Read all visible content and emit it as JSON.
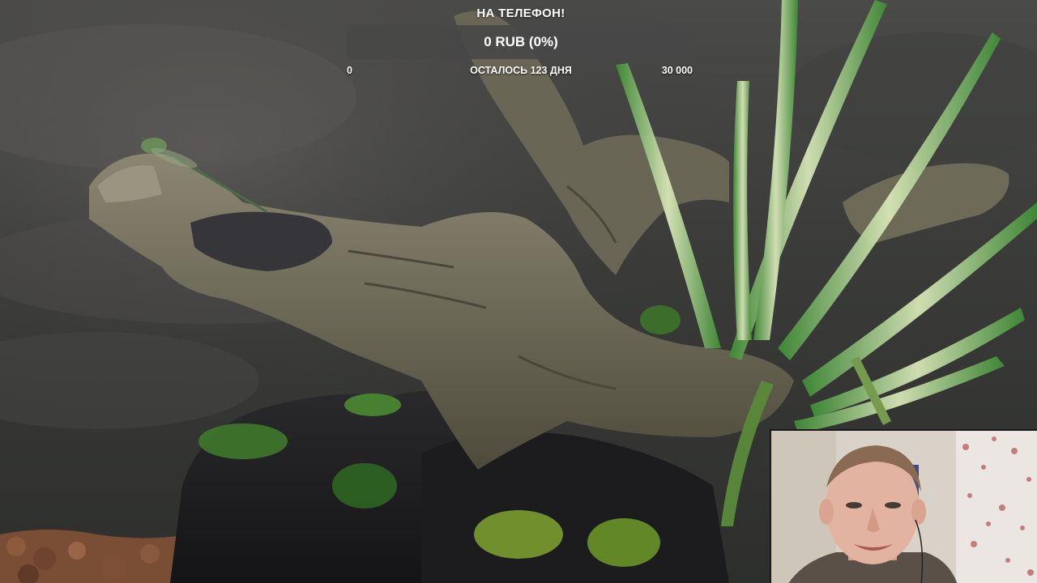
{
  "goal": {
    "title": "НА ТЕЛЕФОН!",
    "amount_text": "0 RUB (0%)",
    "progress_fraction": 0,
    "min_label": "0",
    "remaining_label": "ОСТАЛОСЬ 123 ДНЯ",
    "max_label": "30 000"
  },
  "colors": {
    "goal_bar_bg": "#484848",
    "goal_fill": "#7bd66a",
    "text": "#ffffff"
  }
}
